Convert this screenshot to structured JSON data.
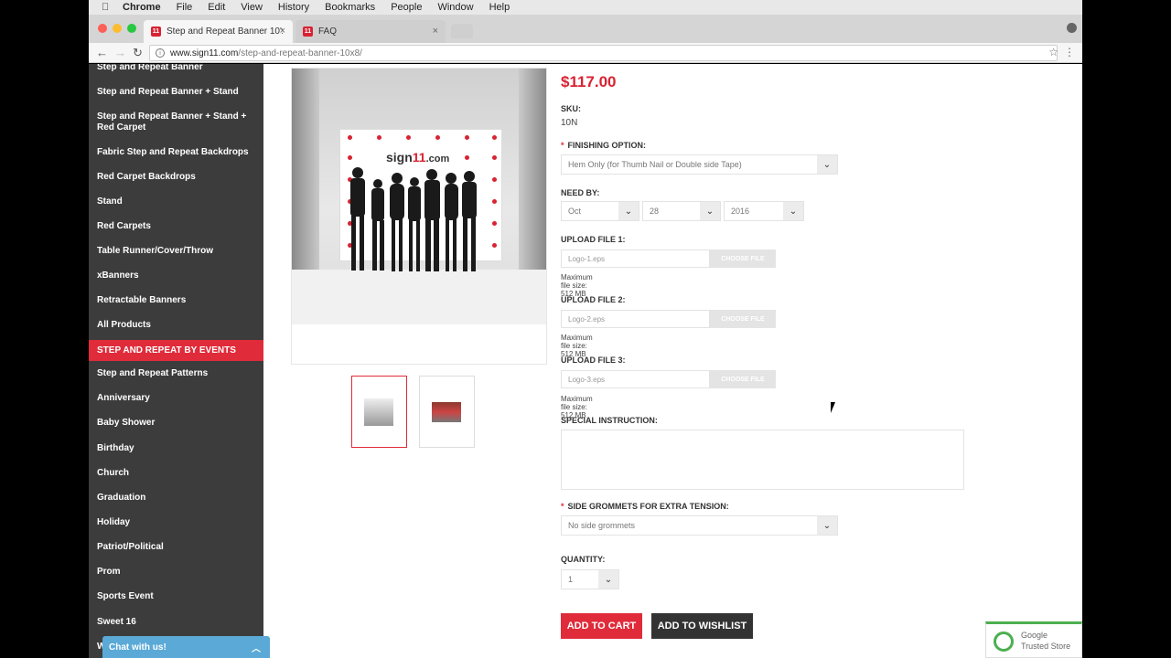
{
  "mac_menu": {
    "items": [
      "Chrome",
      "File",
      "Edit",
      "View",
      "History",
      "Bookmarks",
      "People",
      "Window",
      "Help"
    ]
  },
  "browser": {
    "tabs": [
      {
        "favicon": "11",
        "title": "Step and Repeat Banner 10'x8",
        "active": true
      },
      {
        "favicon": "11",
        "title": "FAQ",
        "active": false
      }
    ],
    "url_host": "www.sign11.com",
    "url_path": "/step-and-repeat-banner-10x8/"
  },
  "sidebar": {
    "items": [
      "Step and Repeat Banner",
      "Step and Repeat Banner + Stand",
      "Step and Repeat Banner + Stand + Red Carpet",
      "Fabric Step and Repeat Backdrops",
      "Red Carpet Backdrops",
      "Stand",
      "Red Carpets",
      "Table Runner/Cover/Throw",
      "xBanners",
      "Retractable Banners",
      "All Products",
      "STEP AND REPEAT BY EVENTS",
      "Step and Repeat Patterns",
      "Anniversary",
      "Baby Shower",
      "Birthday",
      "Church",
      "Graduation",
      "Holiday",
      "Patriot/Political",
      "Prom",
      "Sports Event",
      "Sweet 16",
      "W"
    ],
    "highlight_color": "#e02b3a"
  },
  "chat": {
    "label": "Chat with us!"
  },
  "product": {
    "banner_logo_prefix": "sign",
    "banner_logo_mid": "11",
    "banner_logo_suffix": ".com",
    "price": "$117.00",
    "sku_label": "SKU:",
    "sku_value": "10N",
    "finishing_label": "FINISHING OPTION:",
    "finishing_value": "Hem Only (for Thumb Nail or Double side Tape)",
    "need_by_label": "NEED BY:",
    "month": "Oct",
    "day": "28",
    "year": "2016",
    "upload1_label": "UPLOAD FILE 1:",
    "upload1_placeholder": "Logo-1.eps",
    "upload2_label": "UPLOAD FILE 2:",
    "upload2_placeholder": "Logo-2.eps",
    "upload3_label": "UPLOAD FILE 3:",
    "upload3_placeholder": "Logo-3.eps",
    "choose_file": "CHOOSE FILE",
    "max_size": "Maximum file size: 512 MB",
    "special_label": "SPECIAL INSTRUCTION:",
    "grommets_label": "SIDE GROMMETS FOR EXTRA TENSION:",
    "grommets_value": "No side grommets",
    "quantity_label": "QUANTITY:",
    "quantity_value": "1",
    "add_to_cart": "ADD TO CART",
    "add_to_wishlist": "ADD TO WISHLIST"
  },
  "trusted_store": {
    "line1": "Google",
    "line2": "Trusted Store"
  },
  "colors": {
    "accent": "#e02b3a",
    "sidebar_bg": "#3c3c3c"
  }
}
